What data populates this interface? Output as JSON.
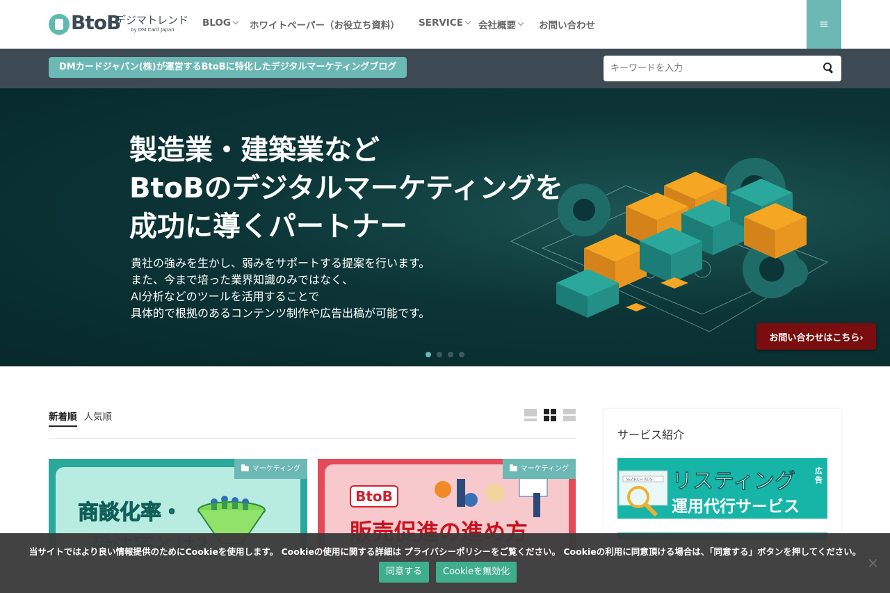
{
  "header": {
    "logo_main": "BtoB",
    "logo_jp": "デジマトレンド",
    "logo_sub": "by DM Card Japan",
    "nav": [
      {
        "label": "BLOG",
        "dropdown": true
      },
      {
        "label": "ホワイトペーパー（お役立ち資料）",
        "dropdown": false
      },
      {
        "label": "SERVICE",
        "dropdown": true
      },
      {
        "label": "会社概要",
        "dropdown": true
      },
      {
        "label": "お問い合わせ",
        "dropdown": false
      }
    ],
    "menu_icon": "≡"
  },
  "subbar": {
    "tagline": "DMカードジャパン(株)が運営するBtoBに特化したデジタルマーケティングブログ",
    "search_placeholder": "キーワードを入力"
  },
  "hero": {
    "title_lines": [
      "製造業・建築業など",
      "BtoBのデジタルマーケティングを",
      "成功に導くパートナー"
    ],
    "desc_lines": [
      "貴社の強みを生かし、弱みをサポートする提案を行います。",
      "また、今まで培った業界知識のみではなく、",
      "AI分析などのツールを活用することで",
      "具体的で根拠のあるコンテンツ制作や広告出稿が可能です。"
    ],
    "cta": "お問い合わせはこちら›",
    "slides": 4,
    "active_slide": 1
  },
  "main": {
    "tabs": [
      "新着順",
      "人気順"
    ],
    "active_tab": 0,
    "cards": [
      {
        "category": "マーケティング",
        "line1": "商談化率・",
        "line2": "受注率とは?"
      },
      {
        "category": "マーケティング",
        "logo": "BtoB",
        "line1": "販売促進の進め方"
      }
    ]
  },
  "sidebar": {
    "title": "サービス紹介",
    "banner_line1": "リスティング",
    "banner_small": "広告",
    "banner_line2": "運用代行サービス",
    "banner_search_label": "SEARCH ADS"
  },
  "cookie": {
    "text": "当サイトではより良い情報提供のためにCookieを使用します。 Cookieの使用に関する詳細は プライバシーポリシーをご覧ください。 Cookieの利用に同意頂ける場合は、「同意する」ボタンを押してください。",
    "accept": "同意する",
    "disable": "Cookieを無効化"
  },
  "colors": {
    "accent": "#6bb8b5",
    "dark_bar": "#3d4a53",
    "hero_bg": "#0c3537",
    "cta": "#7a0d0d",
    "cookie_btn": "#3fae8c"
  }
}
